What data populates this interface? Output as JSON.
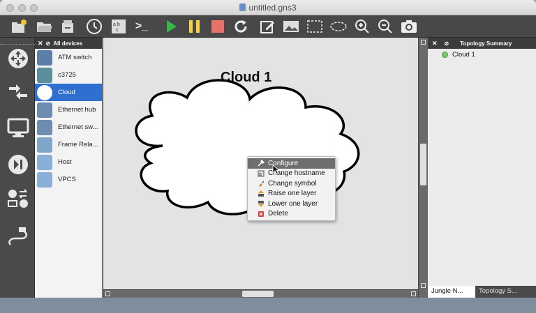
{
  "window": {
    "title": "untitled.gns3"
  },
  "toolbar": {
    "icons": [
      "new-project-icon",
      "open-project-icon",
      "save-project-icon",
      "snapshot-clock-icon",
      "show-interface-labels-icon",
      "console-icon",
      "start-icon",
      "pause-icon",
      "stop-icon",
      "reload-icon",
      "add-note-icon",
      "insert-image-icon",
      "draw-rectangle-icon",
      "draw-ellipse-icon",
      "zoom-in-icon",
      "zoom-out-icon",
      "screenshot-icon"
    ],
    "console_label": ">_",
    "abc_label": "abc"
  },
  "devices_panel": {
    "header": "All devices",
    "items": [
      {
        "label": "ATM switch",
        "color": "#5b7fa6"
      },
      {
        "label": "c3725",
        "color": "#5a8f9b"
      },
      {
        "label": "Cloud",
        "color": "#ffffff"
      },
      {
        "label": "Ethernet hub",
        "color": "#6e8db0"
      },
      {
        "label": "Ethernet sw...",
        "color": "#6e8db0"
      },
      {
        "label": "Frame Rela...",
        "color": "#7fa6c8"
      },
      {
        "label": "Host",
        "color": "#8ab0d8"
      },
      {
        "label": "VPCS",
        "color": "#8ab0d8"
      }
    ],
    "selected_index": 2
  },
  "canvas": {
    "node_label": "Cloud 1"
  },
  "context_menu": {
    "items": [
      "Configure",
      "Change hostname",
      "Change symbol",
      "Raise one layer",
      "Lower one layer",
      "Delete"
    ],
    "highlighted_index": 0
  },
  "topology_summary": {
    "header": "Topology Summary",
    "nodes": [
      "Cloud 1"
    ]
  },
  "bottom_tabs": [
    "Jungle N...",
    "Topology S..."
  ],
  "colors": {
    "selection": "#2f6fd0",
    "play": "#3ab54a",
    "pause": "#f4d34a",
    "stop": "#e8716a",
    "node_status": "#7cc36e"
  }
}
